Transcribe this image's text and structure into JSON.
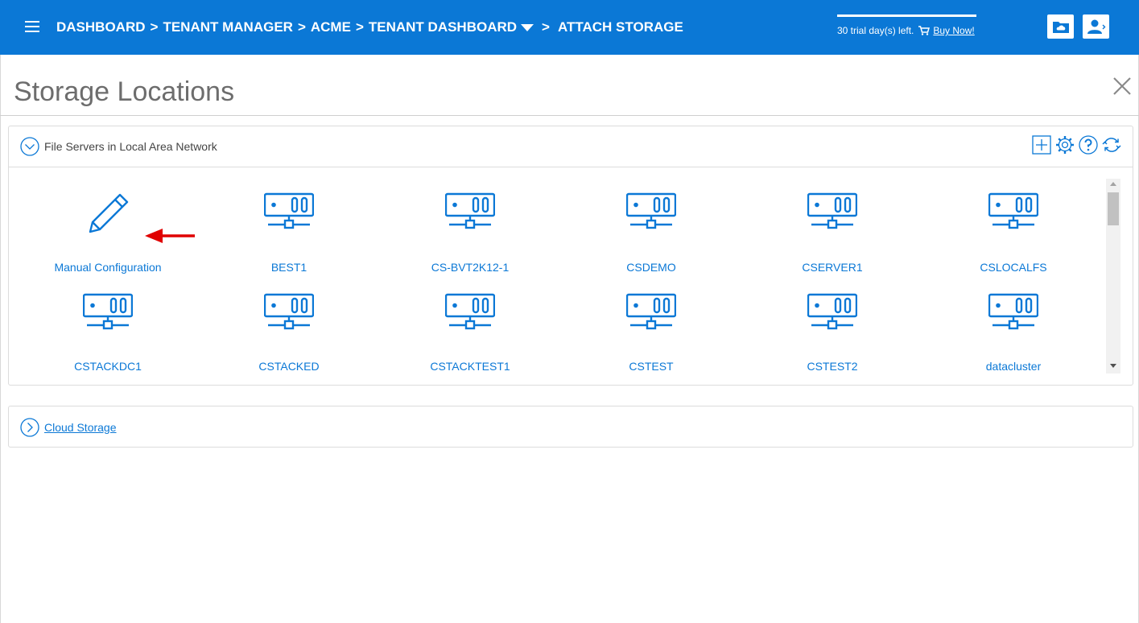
{
  "header": {
    "breadcrumbs": [
      "DASHBOARD",
      "TENANT MANAGER",
      "ACME",
      "TENANT DASHBOARD"
    ],
    "separator": ">",
    "current": "ATTACH STORAGE",
    "trial_text": "30 trial day(s) left.",
    "buy_now": "Buy Now!",
    "icons": [
      "menu-icon",
      "cart-icon",
      "cloud-folder-icon",
      "user-icon"
    ]
  },
  "page": {
    "title": "Storage Locations"
  },
  "lan_panel": {
    "title": "File Servers in Local Area Network",
    "tools": [
      "add-icon",
      "gear-icon",
      "help-icon",
      "refresh-icon"
    ],
    "items": [
      {
        "label": "Manual Configuration",
        "icon": "pencil-icon"
      },
      {
        "label": "BEST1",
        "icon": "server-icon"
      },
      {
        "label": "CS-BVT2K12-1",
        "icon": "server-icon"
      },
      {
        "label": "CSDEMO",
        "icon": "server-icon"
      },
      {
        "label": "CSERVER1",
        "icon": "server-icon"
      },
      {
        "label": "CSLOCALFS",
        "icon": "server-icon"
      },
      {
        "label": "CSTACKDC1",
        "icon": "server-icon"
      },
      {
        "label": "CSTACKED",
        "icon": "server-icon"
      },
      {
        "label": "CSTACKTEST1",
        "icon": "server-icon"
      },
      {
        "label": "CSTEST",
        "icon": "server-icon"
      },
      {
        "label": "CSTEST2",
        "icon": "server-icon"
      },
      {
        "label": "datacluster",
        "icon": "server-icon"
      }
    ]
  },
  "cloud_panel": {
    "title": "Cloud Storage"
  },
  "colors": {
    "brand_blue": "#0b78d6",
    "arrow_red": "#e00000"
  }
}
